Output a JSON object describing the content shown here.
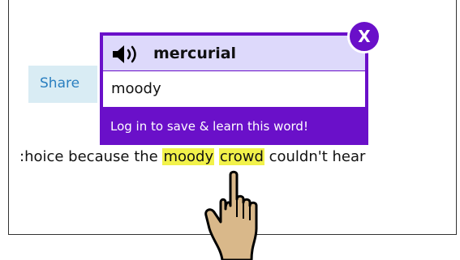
{
  "share": {
    "label": "Share"
  },
  "sentence": {
    "before": ":hoice because the ",
    "highlight1": "moody",
    "between": " ",
    "highlight2": "crowd",
    "after": " couldn't hear"
  },
  "popup": {
    "word": "mercurial",
    "definition": "moody",
    "cta": "Log in to save & learn this word!",
    "close_label": "X",
    "accent_color": "#6a10c9",
    "header_color": "#ddd9fb"
  },
  "highlight_color": "#f2f24a",
  "icons": {
    "speaker": "speaker-icon",
    "pointer": "pointing-hand-icon"
  }
}
